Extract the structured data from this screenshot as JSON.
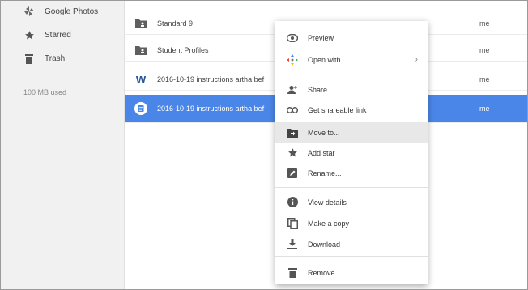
{
  "sidebar": {
    "items": [
      {
        "label": "Google Photos",
        "icon": "google-photos-icon"
      },
      {
        "label": "Starred",
        "icon": "star-icon"
      },
      {
        "label": "Trash",
        "icon": "trash-icon"
      }
    ],
    "storage": "100 MB used"
  },
  "files": [
    {
      "name": "Standard 9",
      "owner": "me",
      "type": "shared-folder"
    },
    {
      "name": "Student Profiles",
      "owner": "me",
      "type": "shared-folder"
    },
    {
      "name": "2016-10-19 instructions artha bef",
      "owner": "me",
      "type": "word-doc"
    },
    {
      "name": "2016-10-19 instructions artha bef",
      "owner": "me",
      "type": "google-doc",
      "selected": true
    }
  ],
  "context_menu": {
    "items": [
      {
        "label": "Preview",
        "icon": "eye-icon"
      },
      {
        "label": "Open with",
        "icon": "open-with-icon",
        "submenu": true
      },
      {
        "label": "Share...",
        "icon": "share-person-icon"
      },
      {
        "label": "Get shareable link",
        "icon": "link-icon"
      },
      {
        "label": "Move to...",
        "icon": "move-folder-icon",
        "active": true
      },
      {
        "label": "Add star",
        "icon": "star-icon"
      },
      {
        "label": "Rename...",
        "icon": "rename-icon"
      },
      {
        "label": "View details",
        "icon": "info-icon"
      },
      {
        "label": "Make a copy",
        "icon": "copy-icon"
      },
      {
        "label": "Download",
        "icon": "download-icon"
      },
      {
        "label": "Remove",
        "icon": "trash-icon"
      }
    ],
    "submenu_arrow": "›"
  },
  "colors": {
    "selection": "#4a86e8",
    "sidebar_bg": "#f1f1f1",
    "word_blue": "#2b579a",
    "icon_gray": "#5f5f5f"
  }
}
